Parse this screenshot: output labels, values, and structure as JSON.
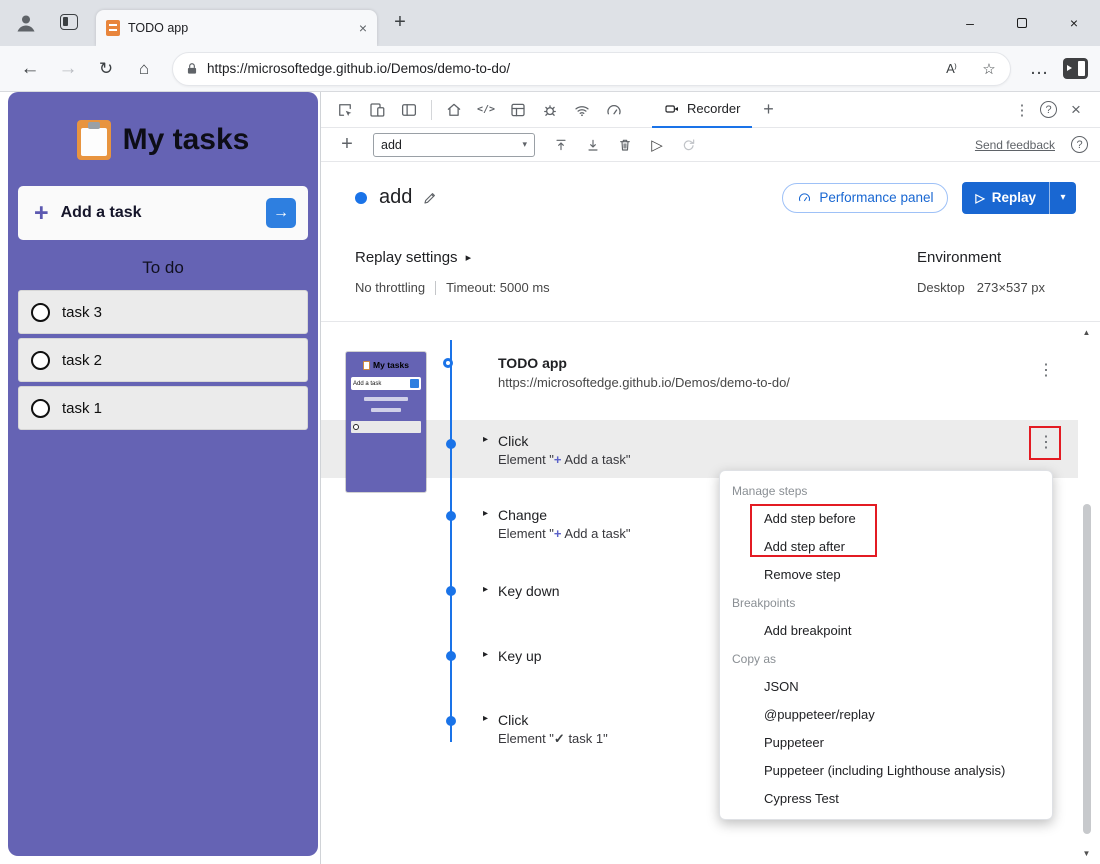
{
  "colors": {
    "accent_blue": "#1a73e8",
    "button_blue": "#1967d2",
    "app_purple": "#6563b4",
    "annotation_red": "#e31b23"
  },
  "icons": {
    "back": "←",
    "forward": "→",
    "refresh": "↻",
    "home": "⌂",
    "read_aloud": "A⁾",
    "star": "☆",
    "more": "…",
    "kebab": "⋮",
    "close": "×",
    "minimize": "–",
    "new_tab": "+",
    "plus": "+",
    "play": "▷",
    "caret_down": "▾",
    "expand": "▸",
    "scroll_up": "▲",
    "scroll_down": "▼",
    "arrow_right": "→",
    "sources": "</>",
    "question": "?"
  },
  "browser": {
    "tab_title": "TODO app",
    "url": "https://microsoftedge.github.io/Demos/demo-to-do/"
  },
  "app": {
    "title": "My tasks",
    "add_task_label": "Add a task",
    "section_title": "To do",
    "tasks": [
      "task 3",
      "task 2",
      "task 1"
    ]
  },
  "devtools": {
    "recorder_tab": "Recorder",
    "toolbar": {
      "recording_select": "add",
      "send_feedback": "Send feedback"
    },
    "header": {
      "recording_name": "add",
      "performance_panel": "Performance panel",
      "replay": "Replay"
    },
    "settings": {
      "title": "Replay settings",
      "throttling": "No throttling",
      "timeout": "Timeout: 5000 ms",
      "environment": "Environment",
      "device": "Desktop",
      "viewport": "273×537 px"
    },
    "thumbnail": {
      "title": "My tasks",
      "add_label": "Add a task"
    },
    "steps": [
      {
        "title": "TODO app",
        "url": "https://microsoftedge.github.io/Demos/demo-to-do/"
      },
      {
        "action": "Click",
        "element_prefix": "Element \"",
        "element_icon": "+",
        "element_suffix": " Add a task\""
      },
      {
        "action": "Change",
        "element_prefix": "Element \"",
        "element_icon": "+",
        "element_suffix": " Add a task\""
      },
      {
        "action": "Key down"
      },
      {
        "action": "Key up"
      },
      {
        "action": "Click",
        "element_prefix": "Element \"",
        "element_icon": "✓",
        "element_suffix": " task 1\""
      }
    ],
    "menu": {
      "items": [
        {
          "label": "Manage steps",
          "kind": "header"
        },
        {
          "label": "Add step before"
        },
        {
          "label": "Add step after"
        },
        {
          "label": "Remove step"
        },
        {
          "label": "Breakpoints",
          "kind": "header"
        },
        {
          "label": "Add breakpoint"
        },
        {
          "label": "Copy as",
          "kind": "header"
        },
        {
          "label": "JSON"
        },
        {
          "label": "@puppeteer/replay"
        },
        {
          "label": "Puppeteer"
        },
        {
          "label": "Puppeteer (including Lighthouse analysis)"
        },
        {
          "label": "Cypress Test"
        }
      ]
    }
  }
}
